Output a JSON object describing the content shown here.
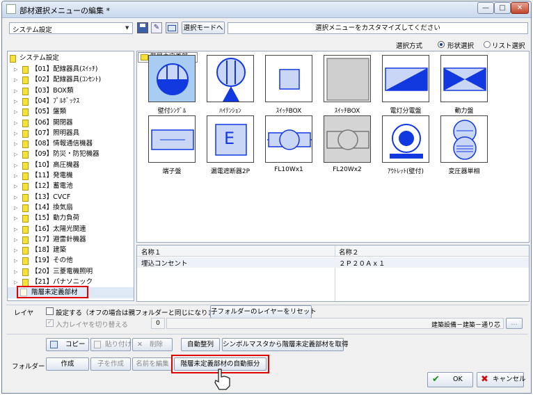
{
  "window": {
    "title": "部材選択メニューの編集 *",
    "min_label": "—",
    "max_label": "□",
    "close_label": "✕"
  },
  "toolbar": {
    "combo_value": "システム設定",
    "mode_button_label": "選択モードへ",
    "message": "選択メニューをカスタマイズしてください",
    "selection_method_label": "選択方式",
    "radio_shape_label": "形状選択",
    "radio_list_label": "リスト選択"
  },
  "tree": {
    "root_label": "システム設定",
    "items": [
      {
        "label": "【01】配線器具(ｽｲｯﾁ)"
      },
      {
        "label": "【02】配線器具(ｺﾝｾﾝﾄ)"
      },
      {
        "label": "【03】BOX類"
      },
      {
        "label": "【04】ﾌﾟﾙﾎﾞｯｸｽ"
      },
      {
        "label": "【05】盤類"
      },
      {
        "label": "【06】開閉器"
      },
      {
        "label": "【07】照明器具"
      },
      {
        "label": "【08】情報通信機器"
      },
      {
        "label": "【09】防災・防犯機器"
      },
      {
        "label": "【10】高圧機器"
      },
      {
        "label": "【11】発電機"
      },
      {
        "label": "【12】蓄電池"
      },
      {
        "label": "【13】CVCF"
      },
      {
        "label": "【14】換気扇"
      },
      {
        "label": "【15】動力負荷"
      },
      {
        "label": "【16】太陽光関連"
      },
      {
        "label": "【17】避雷針機器"
      },
      {
        "label": "【18】建築"
      },
      {
        "label": "【19】その他"
      },
      {
        "label": "【20】三菱電機照明"
      },
      {
        "label": "【21】パナソニック"
      }
    ],
    "selected_label": "階層未定義部材"
  },
  "palette": {
    "folder_label": "階層未定義部...",
    "tiles": [
      {
        "label": "壁付ｼﾝｸﾞﾙ",
        "icon": "wall-single-outlet-icon"
      },
      {
        "label": "ﾊｲﾃﾝｼｮﾝ",
        "icon": "high-tension-icon"
      },
      {
        "label": "ｽｲｯﾁBOX",
        "icon": "switch-box-icon"
      },
      {
        "label": "ｽｲｯﾁBOX",
        "icon": "switch-box-gray-icon"
      },
      {
        "label": "電灯分電盤",
        "icon": "lighting-panel-icon"
      },
      {
        "label": "動力盤",
        "icon": "power-panel-icon"
      },
      {
        "label": "端子盤",
        "icon": "terminal-board-icon"
      },
      {
        "label": "漏電遮断器2P",
        "icon": "earth-leakage-breaker-icon"
      },
      {
        "label": "FL10Wx1",
        "icon": "fluorescent-light-icon"
      },
      {
        "label": "FL20Wx2",
        "icon": "fluorescent-light-gray-icon"
      },
      {
        "label": "ｱｳﾄﾚｯﾄ(壁付)",
        "icon": "outlet-wall-icon"
      },
      {
        "label": "変圧器単相",
        "icon": "transformer-icon"
      }
    ],
    "tile_letter_e": "E"
  },
  "details": {
    "headers": [
      "名称１",
      "名称２"
    ],
    "row": [
      "埋込コンセント",
      "２Ｐ２０Ａｘ１"
    ]
  },
  "layer": {
    "label": "レイヤ",
    "set_checkbox_label": "設定する（オフの場合は親フォルダーと同じになります）",
    "reset_button_label": "子フォルダーのレイヤーをリセット",
    "switch_checkbox_label": "入力レイヤを切り替える",
    "number_value": "0",
    "path_value": "建築設備－建築－通り芯",
    "browse_label": "..."
  },
  "actions": {
    "copy_label": "コピー",
    "paste_label": "貼り付け",
    "delete_label": "削除",
    "auto_arrange_label": "自動整列",
    "symbol_master_label": "シンボルマスタから階層未定義部材を取得"
  },
  "folder": {
    "label": "フォルダー",
    "create_label": "作成",
    "create_child_label": "子を作成",
    "rename_label": "名前を編集",
    "auto_distribute_label": "階層未定義部材の自動振分"
  },
  "dialog": {
    "ok_label": "OK",
    "cancel_label": "キャンセル"
  },
  "colors": {
    "accent_red": "#e00000",
    "shape_blue": "#1238e0",
    "shape_fill": "#c9d6f6",
    "selected_tile_bg": "#a9cdf2"
  }
}
